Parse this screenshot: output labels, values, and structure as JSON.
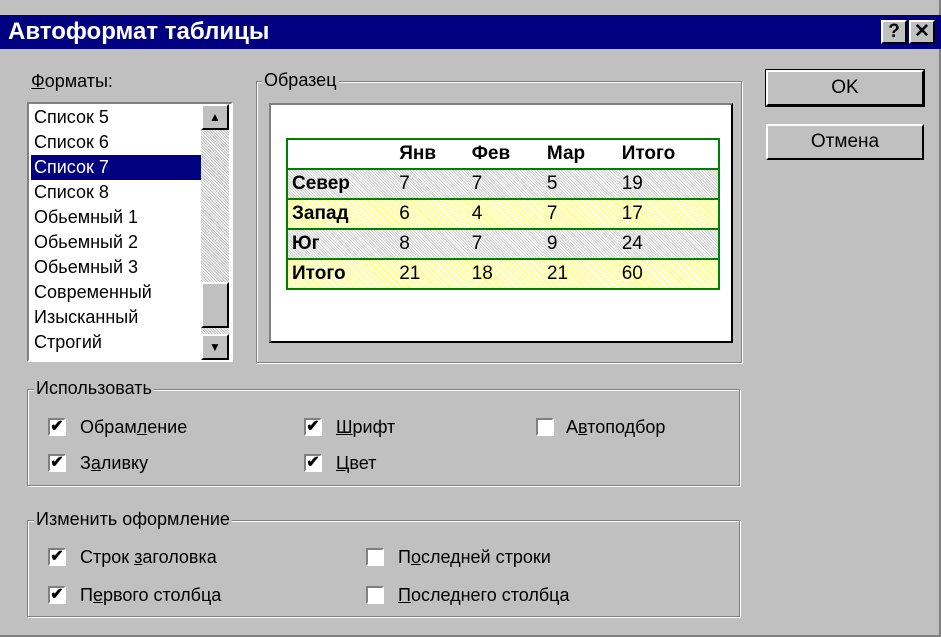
{
  "window": {
    "title": "Автоформат таблицы",
    "help": "?",
    "close": "✕"
  },
  "formats": {
    "label_u": "Ф",
    "label_rest": "орматы:",
    "items": [
      "Список 5",
      "Список 6",
      "Список 7",
      "Список 8",
      "Обьемный 1",
      "Обьемный 2",
      "Обьемный 3",
      "Современный",
      "Изысканный",
      "Строгий"
    ],
    "selected": "Список 7",
    "scroll_up": "▲",
    "scroll_down": "▼"
  },
  "sample": {
    "label": "Образец",
    "headers": [
      "",
      "Янв",
      "Фев",
      "Мар",
      "Итого"
    ],
    "rows": [
      [
        "Север",
        "7",
        "7",
        "5",
        "19"
      ],
      [
        "Запад",
        "6",
        "4",
        "7",
        "17"
      ],
      [
        "Юг",
        "8",
        "7",
        "9",
        "24"
      ],
      [
        "Итого",
        "21",
        "18",
        "21",
        "60"
      ]
    ],
    "colors": {
      "border": "#008000",
      "grey_stripe": "#e0e0e0",
      "yellow_stripe": "#ffffc0"
    }
  },
  "buttons": {
    "ok": "OK",
    "cancel": "Отмена"
  },
  "use_group": {
    "label": "Использовать",
    "borders": {
      "pre": "Обрам",
      "u": "л",
      "post": "ение",
      "checked": true
    },
    "fill": {
      "pre": "З",
      "u": "а",
      "post": "ливку",
      "checked": true
    },
    "font": {
      "pre": "",
      "u": "Ш",
      "post": "рифт",
      "checked": true
    },
    "color": {
      "pre": "",
      "u": "Ц",
      "post": "вет",
      "checked": true
    },
    "autofit": {
      "pre": "А",
      "u": "в",
      "post": "топодбор",
      "checked": false
    }
  },
  "change_group": {
    "label": "Изменить оформление",
    "header_rows": {
      "pre": "Строк ",
      "u": "з",
      "post": "аголовка",
      "checked": true
    },
    "first_col": {
      "pre": "П",
      "u": "е",
      "post": "рвого столбца",
      "checked": true
    },
    "last_row": {
      "pre": "П",
      "u": "о",
      "post": "следней строки",
      "checked": false
    },
    "last_col": {
      "pre": "",
      "u": "П",
      "post": "оследнего столбца",
      "checked": false
    }
  },
  "check_mark": "✔"
}
